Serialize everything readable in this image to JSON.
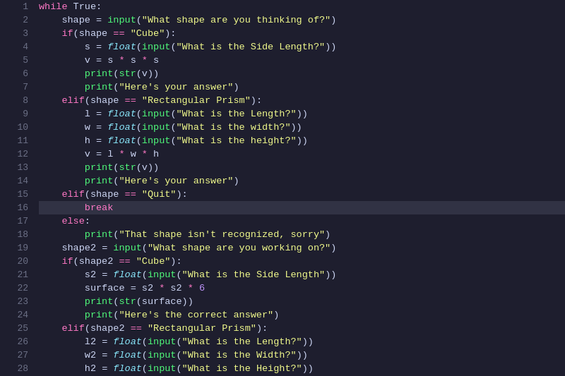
{
  "editor": {
    "lines": [
      {
        "num": 1,
        "highlighted": false
      },
      {
        "num": 2,
        "highlighted": false
      },
      {
        "num": 3,
        "highlighted": false
      },
      {
        "num": 4,
        "highlighted": false
      },
      {
        "num": 5,
        "highlighted": false
      },
      {
        "num": 6,
        "highlighted": false
      },
      {
        "num": 7,
        "highlighted": false
      },
      {
        "num": 8,
        "highlighted": false
      },
      {
        "num": 9,
        "highlighted": false
      },
      {
        "num": 10,
        "highlighted": false
      },
      {
        "num": 11,
        "highlighted": false
      },
      {
        "num": 12,
        "highlighted": false
      },
      {
        "num": 13,
        "highlighted": false
      },
      {
        "num": 14,
        "highlighted": false
      },
      {
        "num": 15,
        "highlighted": false
      },
      {
        "num": 16,
        "highlighted": true
      },
      {
        "num": 17,
        "highlighted": false
      },
      {
        "num": 18,
        "highlighted": false
      },
      {
        "num": 19,
        "highlighted": false
      },
      {
        "num": 20,
        "highlighted": false
      },
      {
        "num": 21,
        "highlighted": false
      },
      {
        "num": 22,
        "highlighted": false
      },
      {
        "num": 23,
        "highlighted": false
      },
      {
        "num": 24,
        "highlighted": false
      },
      {
        "num": 25,
        "highlighted": false
      },
      {
        "num": 26,
        "highlighted": false
      },
      {
        "num": 27,
        "highlighted": false
      },
      {
        "num": 28,
        "highlighted": false
      }
    ]
  }
}
